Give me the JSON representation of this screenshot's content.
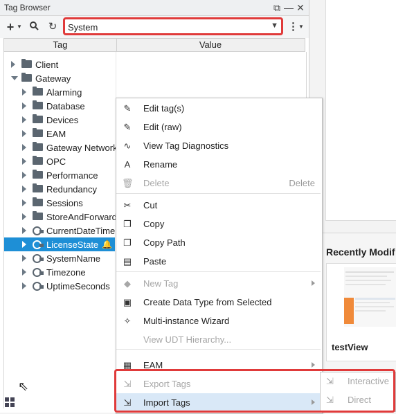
{
  "window": {
    "title": "Tag Browser"
  },
  "toolbar": {
    "provider_value": "System"
  },
  "columns": {
    "tag": "Tag",
    "value": "Value"
  },
  "tree": {
    "items": [
      {
        "label": "Client",
        "type": "folder",
        "level": 0,
        "expanded": false
      },
      {
        "label": "Gateway",
        "type": "folder",
        "level": 0,
        "expanded": true
      },
      {
        "label": "Alarming",
        "type": "folder",
        "level": 1
      },
      {
        "label": "Database",
        "type": "folder",
        "level": 1
      },
      {
        "label": "Devices",
        "type": "folder",
        "level": 1
      },
      {
        "label": "EAM",
        "type": "folder",
        "level": 1
      },
      {
        "label": "Gateway Network",
        "type": "folder",
        "level": 1
      },
      {
        "label": "OPC",
        "type": "folder",
        "level": 1
      },
      {
        "label": "Performance",
        "type": "folder",
        "level": 1
      },
      {
        "label": "Redundancy",
        "type": "folder",
        "level": 1
      },
      {
        "label": "Sessions",
        "type": "folder",
        "level": 1
      },
      {
        "label": "StoreAndForward",
        "type": "folder",
        "level": 1
      },
      {
        "label": "CurrentDateTime",
        "type": "tag",
        "level": 1
      },
      {
        "label": "LicenseState",
        "type": "tag",
        "level": 1,
        "selected": true
      },
      {
        "label": "SystemName",
        "type": "tag",
        "level": 1
      },
      {
        "label": "Timezone",
        "type": "tag",
        "level": 1
      },
      {
        "label": "UptimeSeconds",
        "type": "tag",
        "level": 1
      }
    ]
  },
  "context_menu": {
    "items": [
      {
        "label": "Edit tag(s)",
        "icon": "pencil-icon",
        "enabled": true
      },
      {
        "label": "Edit (raw)",
        "icon": "pencil-icon",
        "enabled": true
      },
      {
        "label": "View Tag Diagnostics",
        "icon": "pulse-icon",
        "enabled": true
      },
      {
        "label": "Rename",
        "icon": "rename-icon",
        "enabled": true
      },
      {
        "label": "Delete",
        "icon": "trash-icon",
        "enabled": false,
        "shortcut": "Delete"
      },
      {
        "label": "Cut",
        "icon": "scissors-icon",
        "enabled": true
      },
      {
        "label": "Copy",
        "icon": "copy-icon",
        "enabled": true
      },
      {
        "label": "Copy Path",
        "icon": "copy-path-icon",
        "enabled": true
      },
      {
        "label": "Paste",
        "icon": "paste-icon",
        "enabled": true
      },
      {
        "label": "New Tag",
        "icon": "new-tag-icon",
        "enabled": false,
        "submenu": true
      },
      {
        "label": "Create Data Type from Selected",
        "icon": "data-type-icon",
        "enabled": true
      },
      {
        "label": "Multi-instance Wizard",
        "icon": "wand-icon",
        "enabled": true
      },
      {
        "label": "View UDT Hierarchy...",
        "icon": "",
        "enabled": false
      },
      {
        "label": "EAM",
        "icon": "eam-icon",
        "enabled": true,
        "submenu": true
      },
      {
        "label": "Export Tags",
        "icon": "export-icon",
        "enabled": false
      },
      {
        "label": "Import Tags",
        "icon": "import-icon",
        "enabled": true,
        "submenu": true,
        "highlighted": true
      }
    ]
  },
  "import_submenu": {
    "items": [
      {
        "label": "Interactive",
        "icon": "import-icon",
        "enabled": false
      },
      {
        "label": "Direct",
        "icon": "import-icon",
        "enabled": false
      }
    ]
  },
  "right_panel": {
    "recent_heading": "Recently Modif",
    "recent_item": "testView"
  },
  "colors": {
    "selection": "#1e8fd6",
    "highlight_border": "#e03a3a",
    "menu_hover": "#d9e8f7"
  }
}
